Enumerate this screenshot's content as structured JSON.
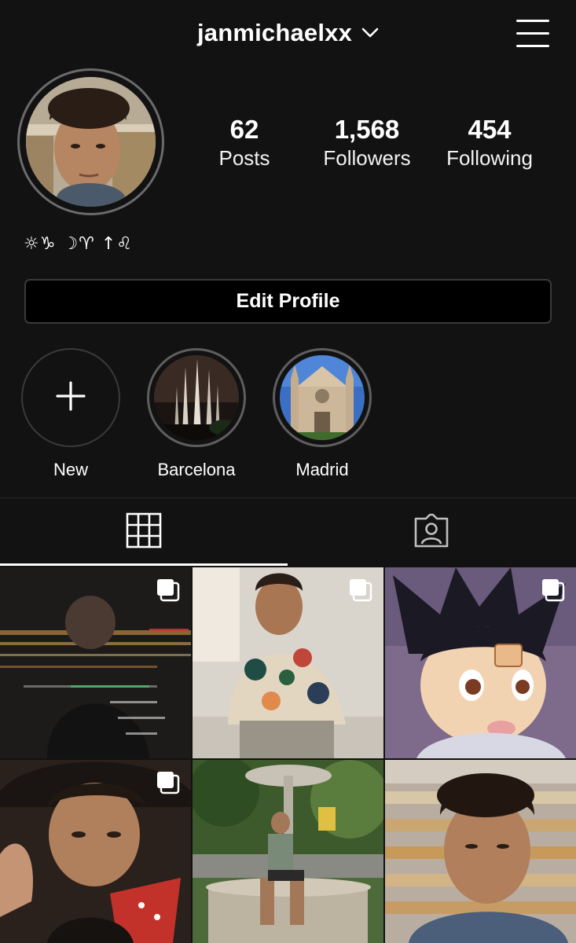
{
  "header": {
    "username": "janmichaelxx",
    "dropdown_icon": "chevron-down-icon",
    "menu_icon": "hamburger-menu-icon"
  },
  "profile": {
    "avatar": "profile-photo",
    "stats": [
      {
        "value": "62",
        "label": "Posts"
      },
      {
        "value": "1,568",
        "label": "Followers"
      },
      {
        "value": "454",
        "label": "Following"
      }
    ],
    "bio": "☼♑ ☽♈ ↑♌",
    "edit_button": "Edit Profile"
  },
  "highlights": [
    {
      "label": "New",
      "icon": "plus-icon"
    },
    {
      "label": "Barcelona",
      "image": "sagrada-familia-night"
    },
    {
      "label": "Madrid",
      "image": "church-facade-blue-sky"
    }
  ],
  "tabs": [
    {
      "name": "posts-grid",
      "icon": "grid-icon",
      "active": true
    },
    {
      "name": "tagged",
      "icon": "tagged-person-icon",
      "active": false
    }
  ],
  "posts": [
    {
      "desc": "night-city-lights-blur",
      "multi": true
    },
    {
      "desc": "man-floral-shirt-sitting",
      "multi": true
    },
    {
      "desc": "anime-boy-character",
      "multi": true
    },
    {
      "desc": "man-red-bandana-hat",
      "multi": true
    },
    {
      "desc": "man-sitting-fountain-park",
      "multi": false
    },
    {
      "desc": "man-selfie-bakery",
      "multi": false
    }
  ],
  "colors": {
    "background": "#121212",
    "text": "#ffffff",
    "button_bg": "#000000",
    "border": "#3a3a3a",
    "divider": "#262626"
  }
}
